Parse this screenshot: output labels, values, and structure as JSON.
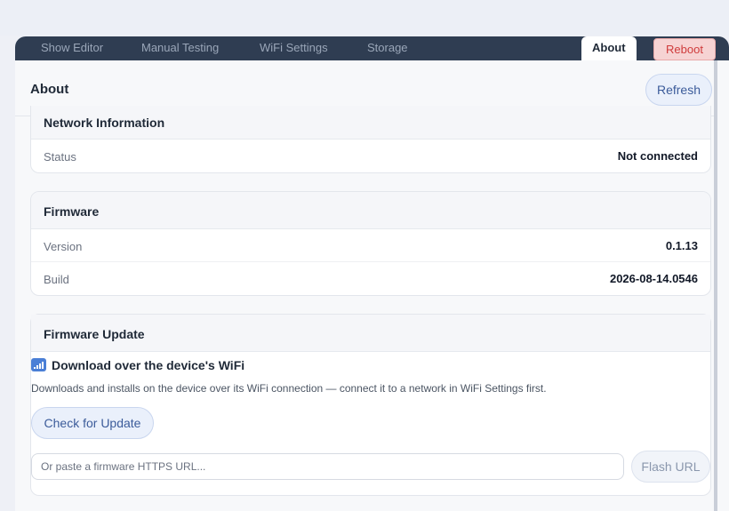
{
  "tabs": [
    {
      "label": "Show Editor"
    },
    {
      "label": "Manual Testing"
    },
    {
      "label": "WiFi Settings"
    },
    {
      "label": "Storage"
    },
    {
      "label": "About"
    }
  ],
  "reboot_label": "Reboot",
  "page": {
    "title": "About",
    "refresh_label": "Refresh"
  },
  "network": {
    "title": "Network Information",
    "rows": [
      {
        "label": "Status",
        "value": "Not connected"
      }
    ]
  },
  "firmware": {
    "title": "Firmware",
    "rows": [
      {
        "label": "Version",
        "value": "0.1.13"
      },
      {
        "label": "Build",
        "value": "2026-08-14.0546"
      }
    ]
  },
  "update": {
    "title": "Firmware Update",
    "download_title": "Download over the device's WiFi",
    "download_desc": "Downloads and installs on the device over its WiFi connection — connect it to a network in WiFi Settings first.",
    "check_label": "Check for Update",
    "url_placeholder": "Or paste a firmware HTTPS URL...",
    "flash_label": "Flash URL"
  },
  "colors": {
    "tabbar": "#2f3d52",
    "accent": "#3b5b9a",
    "danger": "#cf3b3b"
  },
  "icons": {
    "wifi": "wifi-signal-icon"
  }
}
